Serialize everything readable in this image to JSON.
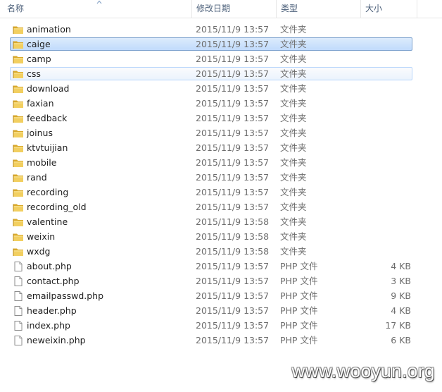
{
  "columns": {
    "name": "名称",
    "date_modified": "修改日期",
    "type": "类型",
    "size": "大小"
  },
  "sort_indicator": "ascending",
  "colors": {
    "selection_border": "#7da2ce",
    "hover_border": "#b8d6fb",
    "folder_yellow": "#e8c04a",
    "text_secondary": "#6d6d6d"
  },
  "files": [
    {
      "name": "animation",
      "date": "2015/11/9 13:57",
      "type": "文件夹",
      "size": "",
      "icon": "folder-icon",
      "state": ""
    },
    {
      "name": "caige",
      "date": "2015/11/9 13:57",
      "type": "文件夹",
      "size": "",
      "icon": "folder-icon",
      "state": "selected"
    },
    {
      "name": "camp",
      "date": "2015/11/9 13:57",
      "type": "文件夹",
      "size": "",
      "icon": "folder-icon",
      "state": ""
    },
    {
      "name": "css",
      "date": "2015/11/9 13:57",
      "type": "文件夹",
      "size": "",
      "icon": "folder-icon",
      "state": "hovered"
    },
    {
      "name": "download",
      "date": "2015/11/9 13:57",
      "type": "文件夹",
      "size": "",
      "icon": "folder-icon",
      "state": ""
    },
    {
      "name": "faxian",
      "date": "2015/11/9 13:57",
      "type": "文件夹",
      "size": "",
      "icon": "folder-icon",
      "state": ""
    },
    {
      "name": "feedback",
      "date": "2015/11/9 13:57",
      "type": "文件夹",
      "size": "",
      "icon": "folder-icon",
      "state": ""
    },
    {
      "name": "joinus",
      "date": "2015/11/9 13:57",
      "type": "文件夹",
      "size": "",
      "icon": "folder-icon",
      "state": ""
    },
    {
      "name": "ktvtuijian",
      "date": "2015/11/9 13:57",
      "type": "文件夹",
      "size": "",
      "icon": "folder-icon",
      "state": ""
    },
    {
      "name": "mobile",
      "date": "2015/11/9 13:57",
      "type": "文件夹",
      "size": "",
      "icon": "folder-icon",
      "state": ""
    },
    {
      "name": "rand",
      "date": "2015/11/9 13:57",
      "type": "文件夹",
      "size": "",
      "icon": "folder-icon",
      "state": ""
    },
    {
      "name": "recording",
      "date": "2015/11/9 13:57",
      "type": "文件夹",
      "size": "",
      "icon": "folder-icon",
      "state": ""
    },
    {
      "name": "recording_old",
      "date": "2015/11/9 13:57",
      "type": "文件夹",
      "size": "",
      "icon": "folder-icon",
      "state": ""
    },
    {
      "name": "valentine",
      "date": "2015/11/9 13:58",
      "type": "文件夹",
      "size": "",
      "icon": "folder-icon",
      "state": ""
    },
    {
      "name": "weixin",
      "date": "2015/11/9 13:58",
      "type": "文件夹",
      "size": "",
      "icon": "folder-icon",
      "state": ""
    },
    {
      "name": "wxdg",
      "date": "2015/11/9 13:58",
      "type": "文件夹",
      "size": "",
      "icon": "folder-icon",
      "state": ""
    },
    {
      "name": "about.php",
      "date": "2015/11/9 13:57",
      "type": "PHP 文件",
      "size": "4 KB",
      "icon": "file-icon",
      "state": ""
    },
    {
      "name": "contact.php",
      "date": "2015/11/9 13:57",
      "type": "PHP 文件",
      "size": "3 KB",
      "icon": "file-icon",
      "state": ""
    },
    {
      "name": "emailpasswd.php",
      "date": "2015/11/9 13:57",
      "type": "PHP 文件",
      "size": "9 KB",
      "icon": "file-icon",
      "state": ""
    },
    {
      "name": "header.php",
      "date": "2015/11/9 13:57",
      "type": "PHP 文件",
      "size": "4 KB",
      "icon": "file-icon",
      "state": ""
    },
    {
      "name": "index.php",
      "date": "2015/11/9 13:57",
      "type": "PHP 文件",
      "size": "17 KB",
      "icon": "file-icon",
      "state": ""
    },
    {
      "name": "neweixin.php",
      "date": "2015/11/9 13:57",
      "type": "PHP 文件",
      "size": "6 KB",
      "icon": "file-icon",
      "state": ""
    }
  ],
  "watermark": "www.wooyun.org"
}
